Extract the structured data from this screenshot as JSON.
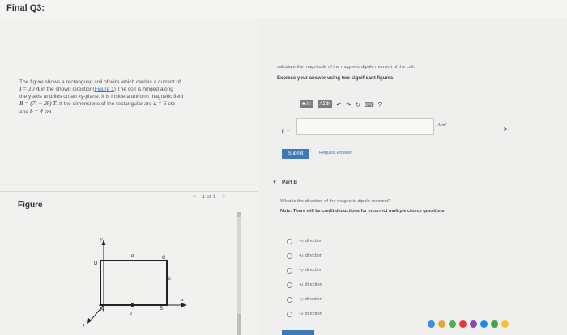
{
  "header": {
    "title": "Final Q3:"
  },
  "problem": {
    "line1": "The figure shows a rectangular coil of wire which carries a current of",
    "current_value": "I = 10 A",
    "line2a": " in the shown direction(",
    "figure_link": "Figure 1",
    "line2b": ") The coil is hinged along",
    "line3": "the y axis and lies on an xy-plane. It is inside a uniform magnetic field",
    "field": "B = (7i − 2k) T",
    "line4": ". If the dimensions of the rectangular are",
    "a_value": "a = 6 cm",
    "line5": "and",
    "b_value": "b = 4 cm"
  },
  "figure": {
    "label": "Figure",
    "pager": {
      "prev": "<",
      "text": "1 of 1",
      "next": ">"
    },
    "diagram": {
      "y": "y",
      "x": "x",
      "z": "z",
      "a": "a",
      "b": "b",
      "I": "I",
      "A": "A",
      "B": "B",
      "C": "C",
      "D": "D"
    }
  },
  "part_a": {
    "question": "calculate the magnitude of the magnetic dipole moment of the coil.",
    "instruction": "Express your answer using two significant figures.",
    "toolbar": {
      "sqrt": "■√□",
      "greek": "ΑΣΦ",
      "undo": "↶",
      "redo": "↷",
      "reset": "↻",
      "keyboard": "⌨",
      "help": "?"
    },
    "mu_label": "μ =",
    "answer_value": "",
    "unit": "A·m²",
    "submit": "Submit",
    "request": "Request Answer"
  },
  "part_b": {
    "title": "Part B",
    "question": "What is the direction of the magnetic dipole moment?",
    "note": "Note: There will be credit deductions for incorrect multiple choice questions.",
    "options": [
      {
        "sign": "−",
        "axis": "x",
        "label": " direction"
      },
      {
        "sign": "+",
        "axis": "x",
        "label": " direction"
      },
      {
        "sign": "−",
        "axis": "y",
        "label": " direction"
      },
      {
        "sign": "+",
        "axis": "z",
        "label": " direction"
      },
      {
        "sign": "+",
        "axis": "y",
        "label": " direction"
      },
      {
        "sign": "−",
        "axis": "z",
        "label": " direction"
      }
    ]
  },
  "colors": {
    "accent": "#3d78b8",
    "panel": "#f1f1f0",
    "background": "#d9d8d6"
  }
}
